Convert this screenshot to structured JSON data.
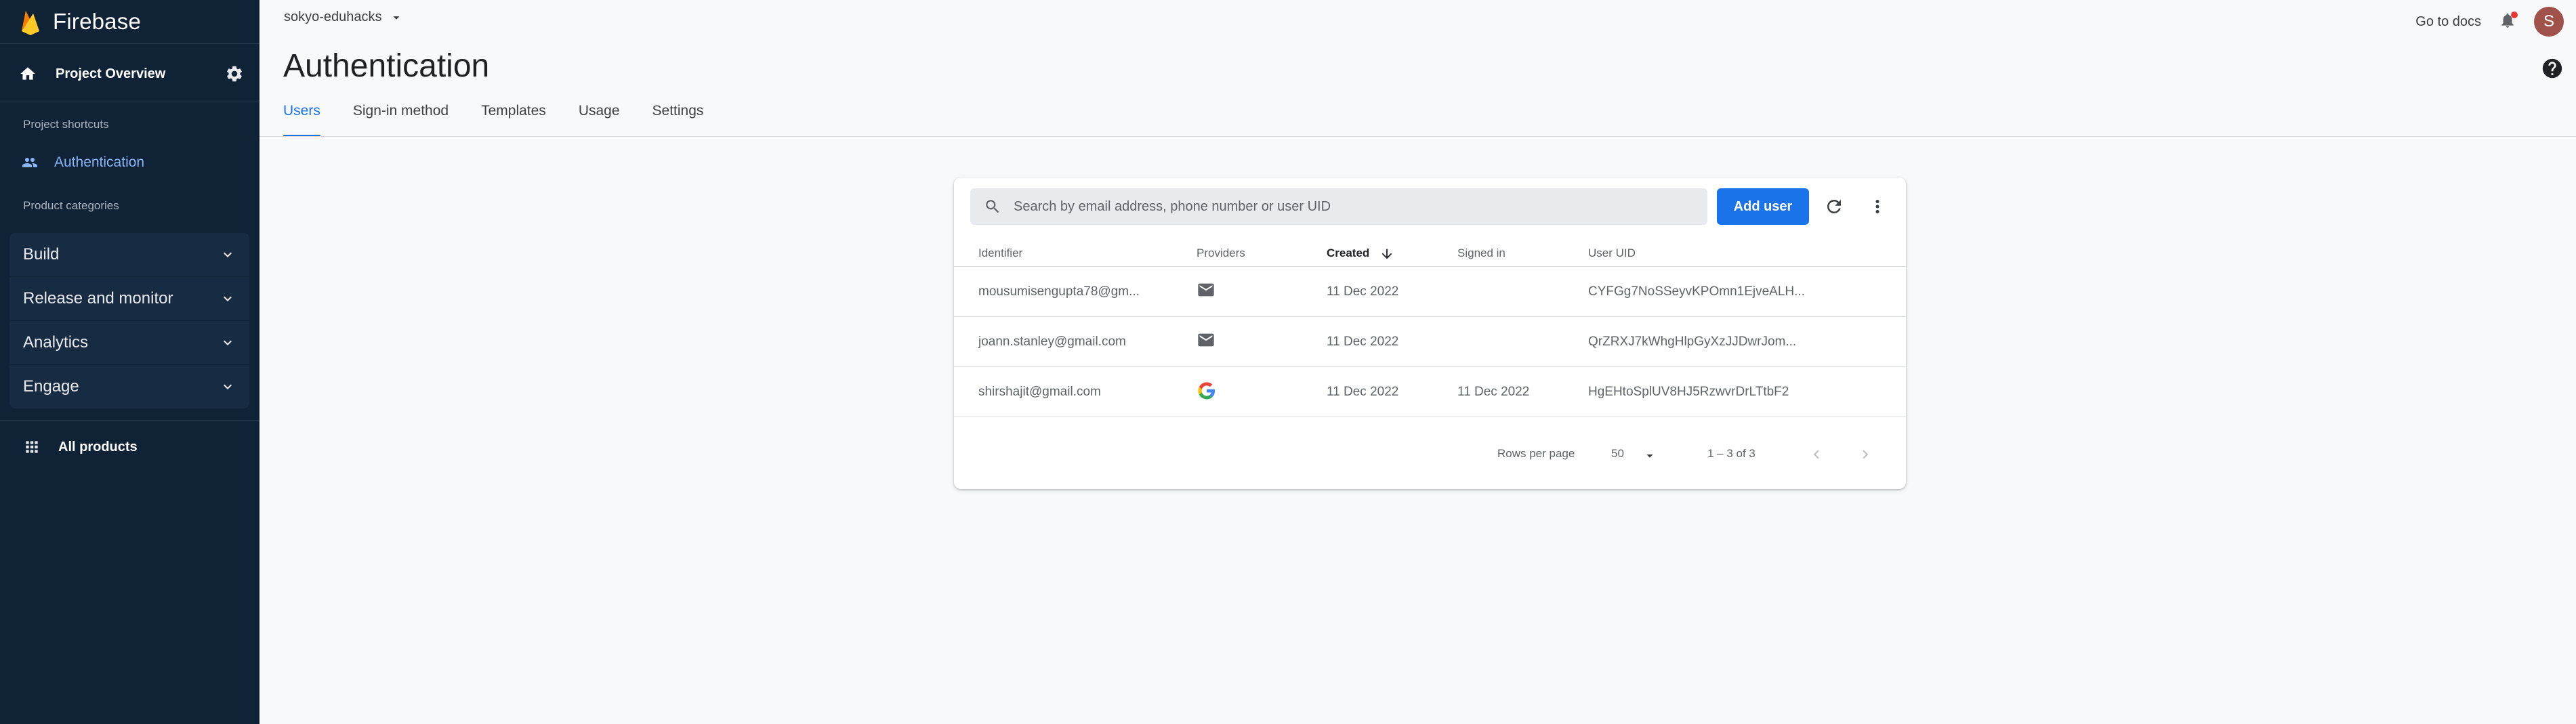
{
  "sidebar": {
    "brand": "Firebase",
    "project_overview": "Project Overview",
    "shortcuts_label": "Project shortcuts",
    "shortcut_auth": "Authentication",
    "categories_label": "Product categories",
    "categories": [
      "Build",
      "Release and monitor",
      "Analytics",
      "Engage"
    ],
    "all_products": "All products"
  },
  "topbar": {
    "project": "sokyo-eduhacks",
    "docs": "Go to docs",
    "avatar": "S"
  },
  "page": {
    "title": "Authentication",
    "tabs": [
      "Users",
      "Sign-in method",
      "Templates",
      "Usage",
      "Settings"
    ]
  },
  "users": {
    "search_placeholder": "Search by email address, phone number or user UID",
    "add_user": "Add user",
    "columns": [
      "Identifier",
      "Providers",
      "Created",
      "Signed in",
      "User UID"
    ],
    "rows": [
      {
        "identifier": "mousumisengupta78@gm...",
        "provider": "email-icon",
        "created": "11 Dec 2022",
        "signed_in": "",
        "uid": "CYFGg7NoSSeyvKPOmn1EjveALH..."
      },
      {
        "identifier": "joann.stanley@gmail.com",
        "provider": "email-icon",
        "created": "11 Dec 2022",
        "signed_in": "",
        "uid": "QrZRXJ7kWhgHlpGyXzJJDwrJom..."
      },
      {
        "identifier": "shirshajit@gmail.com",
        "provider": "google-icon",
        "created": "11 Dec 2022",
        "signed_in": "11 Dec 2022",
        "uid": "HgEHtoSplUV8HJ5RzwvrDrLTtbF2"
      }
    ],
    "rows_per_page_label": "Rows per page",
    "rows_per_page": "50",
    "range": "1 – 3 of 3"
  },
  "colors": {
    "sidebar_bg": "#0f2236",
    "accent": "#1a73e8",
    "avatar": "#a0524a"
  }
}
